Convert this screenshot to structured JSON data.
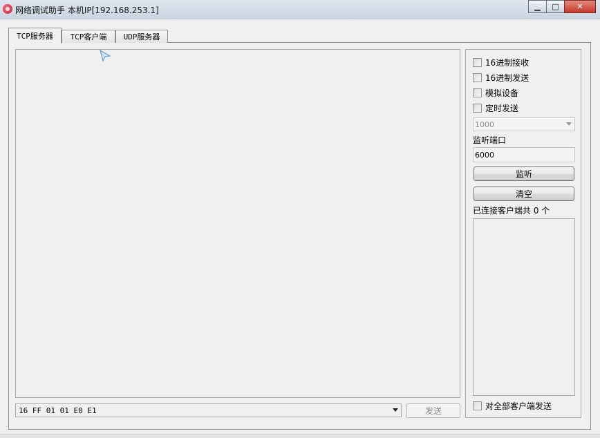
{
  "window": {
    "title": "网络调试助手 本机IP[192.168.253.1]",
    "minimize": "▁",
    "maximize": "□",
    "close": "✕"
  },
  "tabs": [
    {
      "label": "TCP服务器",
      "active": true
    },
    {
      "label": "TCP客户端",
      "active": false
    },
    {
      "label": "UDP服务器",
      "active": false
    }
  ],
  "send": {
    "input_value": "16 FF 01 01 E0 E1",
    "send_label": "发送"
  },
  "options": {
    "hex_receive": "16进制接收",
    "hex_send": "16进制发送",
    "simulate_device": "模拟设备",
    "timed_send": "定时发送",
    "interval_value": "1000",
    "port_label": "监听端口",
    "port_value": "6000",
    "listen_label": "监听",
    "clear_label": "清空",
    "connected_label": "已连接客户端共 0 个",
    "send_all_label": "对全部客户端发送"
  },
  "icons": {
    "app": "network-assistant-icon",
    "cursor": "mouse-cursor-icon"
  }
}
